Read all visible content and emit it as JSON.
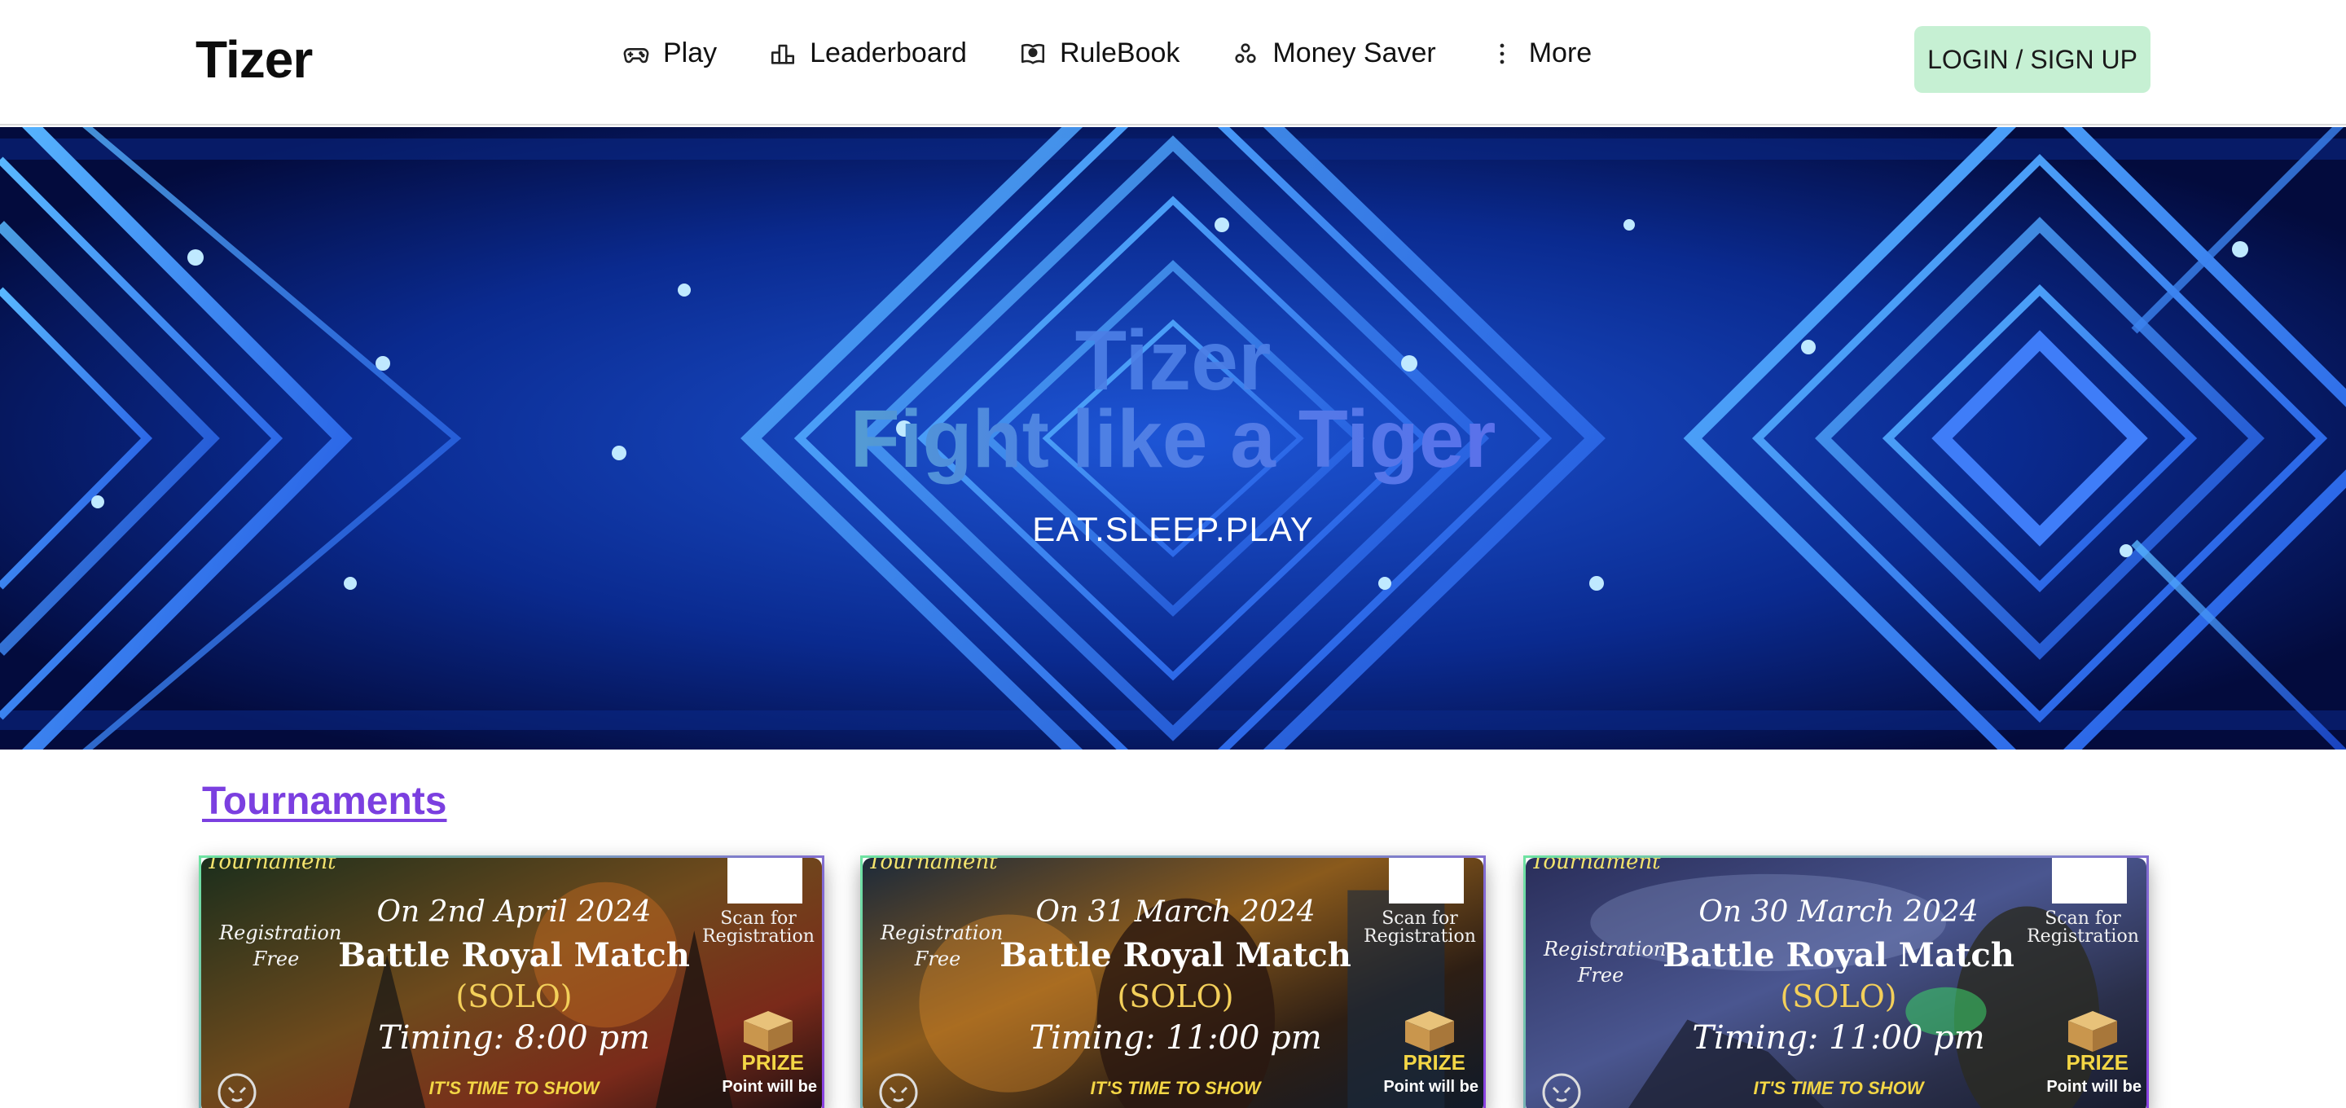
{
  "header": {
    "logo": "Tizer",
    "nav": [
      {
        "label": "Play",
        "icon": "gamepad-icon"
      },
      {
        "label": "Leaderboard",
        "icon": "podium-icon"
      },
      {
        "label": "RuleBook",
        "icon": "rulebook-icon"
      },
      {
        "label": "Money Saver",
        "icon": "coins-icon"
      },
      {
        "label": "More",
        "icon": "more-vertical-icon"
      }
    ],
    "login_label": "LOGIN / SIGN UP",
    "colors": {
      "login_bg": "#c6f0d3"
    }
  },
  "hero": {
    "title": "Tizer",
    "tagline": "Fight like a Tiger",
    "subtitle": "EAT.SLEEP.PLAY",
    "colors": {
      "background": "#04104a",
      "tagline_start": "#7ee0a4",
      "tagline_end": "#9c4fe0"
    }
  },
  "tournaments": {
    "heading": "Tournaments",
    "heading_color": "#7b3fe0",
    "cards": [
      {
        "top_label": "Tournament",
        "registration": "Registration Free",
        "date": "On 2nd April 2024",
        "match": "Battle Royal Match",
        "mode": "(SOLO)",
        "timing": "Timing: 8:00 pm",
        "scan": "Scan for Registration",
        "prize": "PRIZE",
        "point": "Point will be",
        "show": "IT'S TIME TO SHOW"
      },
      {
        "top_label": "Tournament",
        "registration": "Registration Free",
        "date": "On 31 March 2024",
        "match": "Battle Royal Match",
        "mode": "(SOLO)",
        "timing": "Timing: 11:00 pm",
        "scan": "Scan for Registration",
        "prize": "PRIZE",
        "point": "Point will be",
        "show": "IT'S TIME TO SHOW"
      },
      {
        "top_label": "Tournament",
        "registration": "Registration Free",
        "date": "On 30 March 2024",
        "match": "Battle Royal Match",
        "mode": "(SOLO)",
        "timing": "Timing: 11:00 pm",
        "scan": "Scan for Registration",
        "prize": "PRIZE",
        "point": "Point will be",
        "show": "IT'S TIME TO SHOW"
      }
    ]
  }
}
